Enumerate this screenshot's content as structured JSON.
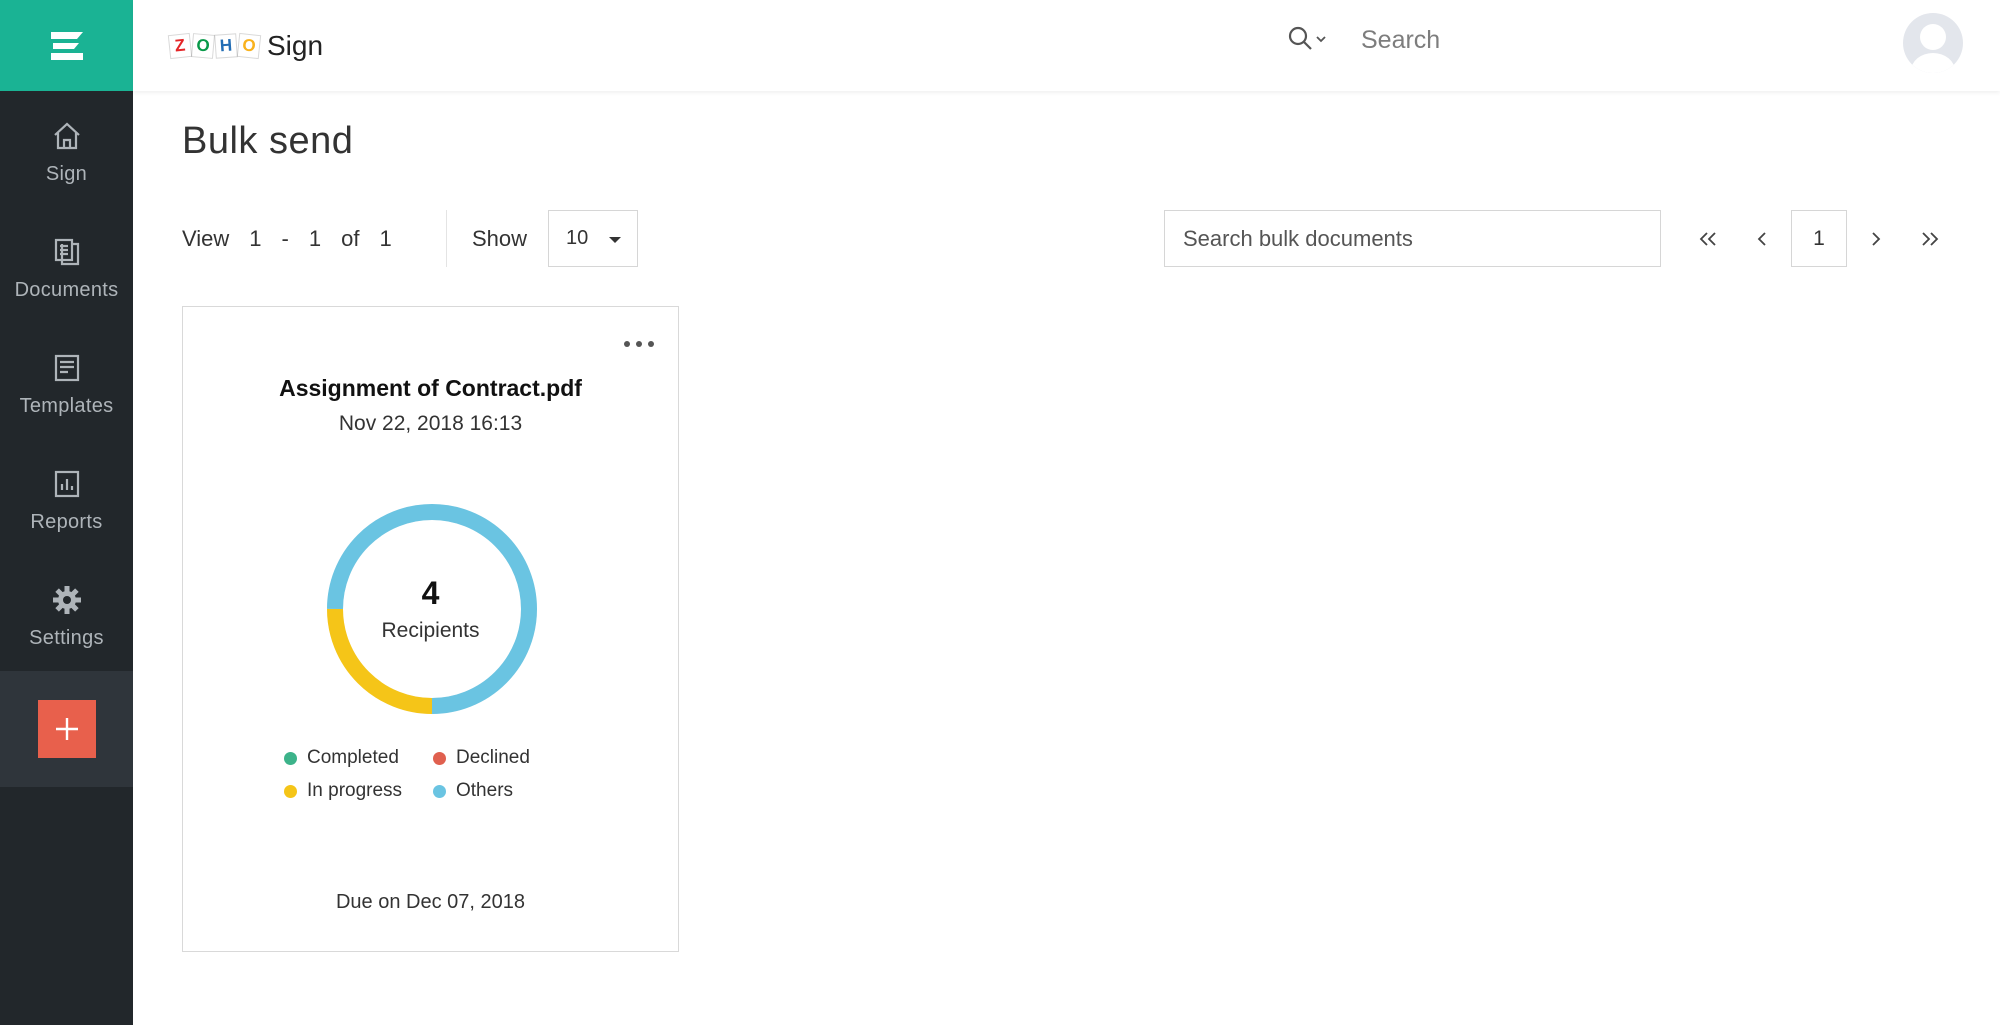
{
  "app": {
    "logo_letters": [
      "Z",
      "O",
      "H",
      "O"
    ],
    "logo_letter_colors": [
      "#e42527",
      "#089949",
      "#226db4",
      "#f9b21d"
    ],
    "product_name": "Sign",
    "brand_color": "#1ab394"
  },
  "header": {
    "search_placeholder": "Search"
  },
  "sidebar": {
    "items": [
      {
        "label": "Sign",
        "icon": "home-icon"
      },
      {
        "label": "Documents",
        "icon": "documents-icon"
      },
      {
        "label": "Templates",
        "icon": "templates-icon"
      },
      {
        "label": "Reports",
        "icon": "reports-icon"
      },
      {
        "label": "Settings",
        "icon": "gear-icon"
      }
    ],
    "new_button_icon": "plus-icon",
    "new_button_color": "#e8604c"
  },
  "page": {
    "title": "Bulk send"
  },
  "toolbar": {
    "view_label": "View",
    "range_start": "1",
    "range_sep": "-",
    "range_end": "1",
    "of_label": "of",
    "total": "1",
    "show_label": "Show",
    "page_size": "10",
    "bulk_search_placeholder": "Search bulk documents",
    "current_page": "1"
  },
  "cards": [
    {
      "title": "Assignment of Contract.pdf",
      "date": "Nov 22, 2018 16:13",
      "recipients_count": "4",
      "recipients_label": "Recipients",
      "due": "Due on Dec 07, 2018",
      "status_breakdown": [
        {
          "name": "Completed",
          "color": "#3cb38a",
          "count": 0
        },
        {
          "name": "Declined",
          "color": "#e0604f",
          "count": 0
        },
        {
          "name": "In progress",
          "color": "#f5c518",
          "count": 1
        },
        {
          "name": "Others",
          "color": "#6ac4e2",
          "count": 3
        }
      ]
    }
  ]
}
